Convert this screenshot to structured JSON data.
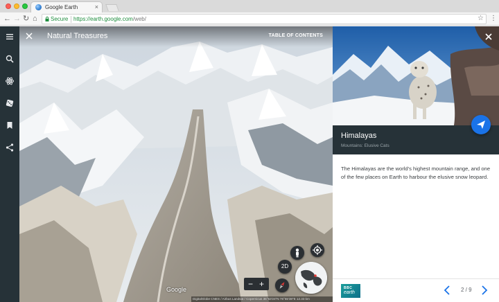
{
  "browser": {
    "tab_title": "Google Earth",
    "tab_close": "×",
    "secure_label": "Secure",
    "url_host": "https://earth.google.com",
    "url_path": "/web/"
  },
  "rail": {
    "icons": [
      "menu-icon",
      "search-icon",
      "voyager-icon",
      "dice-icon",
      "bookmark-icon",
      "share-icon"
    ]
  },
  "map": {
    "story_title": "Natural Treasures",
    "toc_label": "TABLE OF CONTENTS",
    "mode_label": "2D",
    "zoom_out": "−",
    "zoom_in": "+",
    "google_mark": "Google",
    "attribution": "DigitalGlobe  CNES / Airbus  Landsat / Copernicus     35°53'24\"N 76°55'38\"E     12.33 km"
  },
  "card": {
    "title": "Himalayas",
    "subtitle": "Mountains: Elusive Cats",
    "description": "The Himalayas are the world's highest mountain range, and one of the few places on Earth to harbour the elusive snow leopard.",
    "brand_top": "BBC",
    "brand_bottom": "earth",
    "pager": "2 / 9"
  },
  "colors": {
    "rail": "#263238",
    "card_header": "#263238",
    "accent": "#1a73e8",
    "secure_green": "#1e8e3e"
  }
}
